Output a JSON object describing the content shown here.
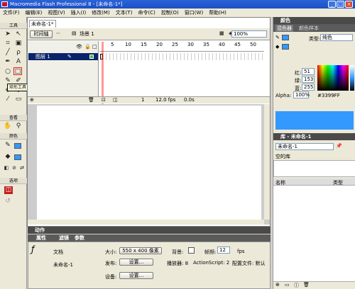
{
  "window": {
    "title": "Macromedia Flash Professional 8 - [未命名-1*]",
    "min": "_",
    "max": "□",
    "close": "×"
  },
  "menu": [
    "文件(F)",
    "编辑(E)",
    "视图(V)",
    "插入(I)",
    "修改(M)",
    "文本(T)",
    "命令(C)",
    "控制(O)",
    "窗口(W)",
    "帮助(H)"
  ],
  "toolbox": {
    "tools_label": "工具",
    "view_label": "查看",
    "colors_label": "颜色",
    "options_label": "选项",
    "tooltip": "矩形工具 (R)"
  },
  "document": {
    "tab": "未命名-1*",
    "timeline_button": "时间轴",
    "scene": "场景 1",
    "zoom": "100%",
    "layer_name": "图层 1",
    "frame_numbers": [
      "5",
      "10",
      "15",
      "20",
      "25",
      "30",
      "35",
      "40",
      "45",
      "50"
    ],
    "current_frame": "1",
    "fps": "12.0 fps",
    "time": "0.0s"
  },
  "panels": {
    "actions": "动作",
    "properties_tabs": [
      "属性",
      "滤镜",
      "参数"
    ],
    "doc_label": "文档",
    "doc_name": "未命名-1",
    "size_label": "大小:",
    "size_value": "550 x 400 像素",
    "bg_label": "背景:",
    "fps_label": "帧频:",
    "fps_value": "12",
    "fps_unit": "fps",
    "publish_label": "发布:",
    "settings_btn": "设置...",
    "player_label": "播放器: 8",
    "as_label": "ActionScript: 2",
    "profile_label": "配置文件: 默认",
    "device_label": "设备:",
    "device_btn": "设置..."
  },
  "color_panel": {
    "title": "颜色",
    "tabs": [
      "混色器",
      "颜色样本"
    ],
    "type_label": "类型:",
    "type_value": "纯色",
    "red_label": "红:",
    "red": "51",
    "green_label": "绿:",
    "green": "153",
    "blue_label": "蓝:",
    "blue": "255",
    "alpha_label": "Alpha:",
    "alpha": "100%",
    "hex": "#3399FF",
    "color": "#3399FF"
  },
  "library_panel": {
    "title": "库 - 未命名-1",
    "dropdown": "未命名-1",
    "empty": "空的库",
    "col_name": "名称",
    "col_type": "类型"
  }
}
